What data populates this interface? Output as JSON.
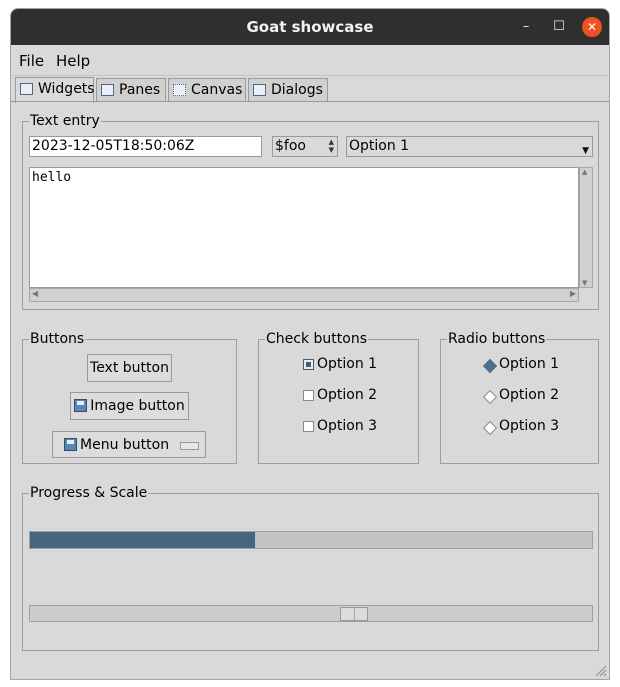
{
  "window": {
    "title": "Goat showcase",
    "minimize_glyph": "–",
    "maximize_glyph": "☐",
    "close_glyph": "✕"
  },
  "menubar": {
    "items": [
      "File",
      "Help"
    ]
  },
  "tabs": [
    {
      "label": "Widgets",
      "icon": "widgets-icon",
      "active": true
    },
    {
      "label": "Panes",
      "icon": "panes-icon",
      "active": false
    },
    {
      "label": "Canvas",
      "icon": "canvas-icon",
      "active": false
    },
    {
      "label": "Dialogs",
      "icon": "dialogs-icon",
      "active": false
    }
  ],
  "text_entry": {
    "group_label": "Text entry",
    "entry_value": "2023-12-05T18:50:06Z",
    "spinbox_value": "$foo",
    "combo_value": "Option 1",
    "textarea_value": "hello"
  },
  "buttons": {
    "group_label": "Buttons",
    "text_button": "Text button",
    "image_button": "Image button",
    "menu_button": "Menu button"
  },
  "check_buttons": {
    "group_label": "Check buttons",
    "options": [
      {
        "label": "Option 1",
        "checked": true
      },
      {
        "label": "Option 2",
        "checked": false
      },
      {
        "label": "Option 3",
        "checked": false
      }
    ]
  },
  "radio_buttons": {
    "group_label": "Radio buttons",
    "options": [
      {
        "label": "Option 1",
        "selected": true
      },
      {
        "label": "Option 2",
        "selected": false
      },
      {
        "label": "Option 3",
        "selected": false
      }
    ]
  },
  "progress_scale": {
    "group_label": "Progress & Scale",
    "progress_fraction": 0.4,
    "scale_fraction": 0.58
  },
  "colors": {
    "titlebar": "#2f2f2f",
    "close_button": "#e95420",
    "accent": "#47657f"
  }
}
